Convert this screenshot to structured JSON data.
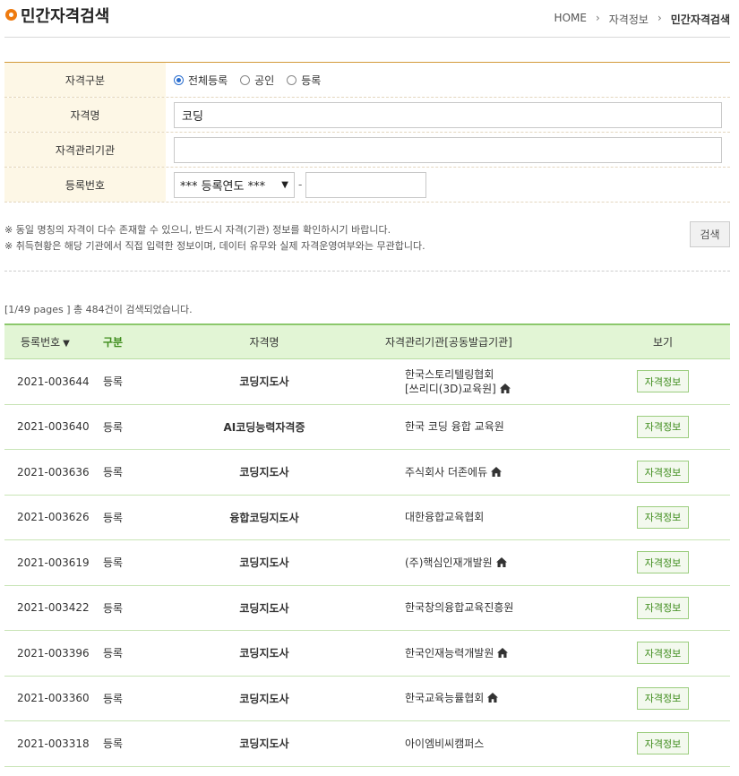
{
  "page_title": "민간자격검색",
  "breadcrumb": [
    "HOME",
    "자격정보",
    "민간자격검색"
  ],
  "form": {
    "type_label": "자격구분",
    "type_options": [
      "전체등록",
      "공인",
      "등록"
    ],
    "type_selected": "전체등록",
    "name_label": "자격명",
    "name_value": "코딩",
    "org_label": "자격관리기관",
    "org_value": "",
    "regno_label": "등록번호",
    "regno_select": "*** 등록연도 ***",
    "regno_dash": "-",
    "regno_value": ""
  },
  "notes": [
    "※ 동일 명칭의 자격이 다수 존재할 수 있으니, 반드시 자격(기관) 정보를 확인하시기 바랍니다.",
    "※ 취득현황은 해당 기관에서 직접 입력한 정보이며, 데이터 유무와 실제 자격운영여부와는 무관합니다."
  ],
  "search_button": "검색",
  "result_info": "[1/49 pages ] 총 484건이 검색되었습니다.",
  "table": {
    "headers": [
      "등록번호",
      "구분",
      "자격명",
      "자격관리기관[공동발급기관]",
      "보기"
    ],
    "sort_arrow": "▼",
    "rows": [
      {
        "regno": "2021-003644",
        "type": "등록",
        "name": "코딩지도사",
        "org": "한국스토리텔링협회",
        "org2": "[쓰리디(3D)교육원]",
        "home": true,
        "view": "자격정보"
      },
      {
        "regno": "2021-003640",
        "type": "등록",
        "name": "AI코딩능력자격증",
        "org": "한국 코딩 융합 교육원",
        "org2": "",
        "home": false,
        "view": "자격정보"
      },
      {
        "regno": "2021-003636",
        "type": "등록",
        "name": "코딩지도사",
        "org": "주식회사 더존에듀",
        "org2": "",
        "home": true,
        "view": "자격정보"
      },
      {
        "regno": "2021-003626",
        "type": "등록",
        "name": "융합코딩지도사",
        "org": "대한융합교육협회",
        "org2": "",
        "home": false,
        "view": "자격정보"
      },
      {
        "regno": "2021-003619",
        "type": "등록",
        "name": "코딩지도사",
        "org": "(주)핵심인재개발원",
        "org2": "",
        "home": true,
        "view": "자격정보"
      },
      {
        "regno": "2021-003422",
        "type": "등록",
        "name": "코딩지도사",
        "org": "한국창의융합교육진흥원",
        "org2": "",
        "home": false,
        "view": "자격정보"
      },
      {
        "regno": "2021-003396",
        "type": "등록",
        "name": "코딩지도사",
        "org": "한국인재능력개발원",
        "org2": "",
        "home": true,
        "view": "자격정보"
      },
      {
        "regno": "2021-003360",
        "type": "등록",
        "name": "코딩지도사",
        "org": "한국교육능률협회",
        "org2": "",
        "home": true,
        "view": "자격정보"
      },
      {
        "regno": "2021-003318",
        "type": "등록",
        "name": "코딩지도사",
        "org": "아이엠비씨캠퍼스",
        "org2": "",
        "home": false,
        "view": "자격정보"
      }
    ]
  }
}
